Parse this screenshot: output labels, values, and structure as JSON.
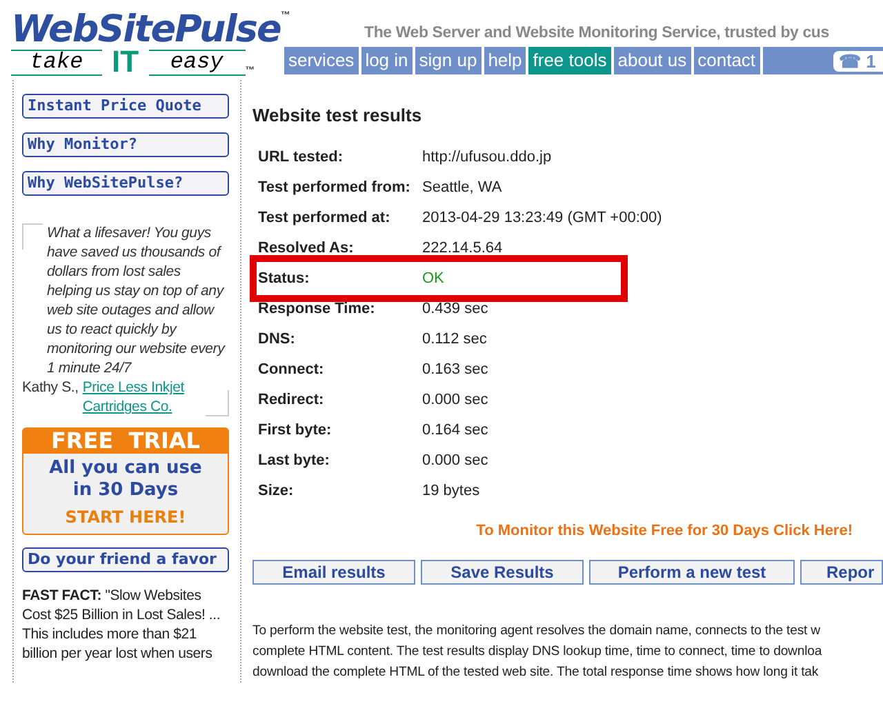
{
  "header": {
    "logo": "WebSitePulse",
    "tm": "™",
    "slogan_left": "take",
    "slogan_mid": "IT",
    "slogan_right": "easy",
    "slogan_tm": "™",
    "tagline": "The Web Server and Website Monitoring Service, trusted by cus",
    "phone": "☎ 1"
  },
  "nav": [
    {
      "label": "services",
      "selected": false
    },
    {
      "label": "log in",
      "selected": false
    },
    {
      "label": "sign up",
      "selected": false
    },
    {
      "label": "help",
      "selected": false
    },
    {
      "label": "free tools",
      "selected": true
    },
    {
      "label": "about us",
      "selected": false
    },
    {
      "label": "contact",
      "selected": false
    }
  ],
  "sidebar": {
    "links": [
      "Instant Price Quote",
      "Why Monitor?",
      "Why WebSitePulse?"
    ],
    "testimonial": {
      "quote": "What a lifesaver! You guys have saved us thousands of dollars from lost sales helping us stay on top of any web site outages and allow us to react quickly by monitoring our website every 1 minute 24/7",
      "author": "Kathy S.,",
      "company": "Price Less Inkjet Cartridges Co."
    },
    "trial": {
      "title": "FREE  TRIAL",
      "body": "All you can use in 30 Days",
      "cta": "START HERE!"
    },
    "favor": "Do your friend a favor",
    "fact": "**FAST FACT:** \"Slow Websites Cost $25 Billion in Lost Sales! ... This includes more than $21 billion per year lost when users"
  },
  "main": {
    "title": "Website test results",
    "rows": [
      {
        "label": "URL tested:",
        "value": "http://ufusou.ddo.jp",
        "highlighted": false,
        "ok": false
      },
      {
        "label": "Test performed from:",
        "value": "Seattle, WA",
        "highlighted": false,
        "ok": false
      },
      {
        "label": "Test performed at:",
        "value": "2013-04-29 13:23:49 (GMT +00:00)",
        "highlighted": false,
        "ok": false
      },
      {
        "label": "Resolved As:",
        "value": "222.14.5.64",
        "highlighted": false,
        "ok": false
      },
      {
        "label": "Status:",
        "value": "OK",
        "highlighted": true,
        "ok": true
      },
      {
        "label": "Response Time:",
        "value": "0.439 sec",
        "highlighted": false,
        "ok": false
      },
      {
        "label": "DNS:",
        "value": "0.112 sec",
        "highlighted": false,
        "ok": false
      },
      {
        "label": "Connect:",
        "value": "0.163 sec",
        "highlighted": false,
        "ok": false
      },
      {
        "label": "Redirect:",
        "value": "0.000 sec",
        "highlighted": false,
        "ok": false
      },
      {
        "label": "First byte:",
        "value": "0.164 sec",
        "highlighted": false,
        "ok": false
      },
      {
        "label": "Last byte:",
        "value": "0.000 sec",
        "highlighted": false,
        "ok": false
      },
      {
        "label": "Size:",
        "value": "19 bytes",
        "highlighted": false,
        "ok": false
      }
    ],
    "promo": "To Monitor this Website Free for 30 Days Click Here!",
    "buttons": [
      "Email results",
      "Save Results",
      "Perform a new test",
      "Repor"
    ],
    "description": [
      "To perform the website test, the monitoring agent resolves the domain name, connects to the test w",
      "complete HTML content. The test results display DNS lookup time, time to connect, time to downloa",
      "download the complete HTML of the tested web site. The total response time shows how long it tak"
    ]
  }
}
